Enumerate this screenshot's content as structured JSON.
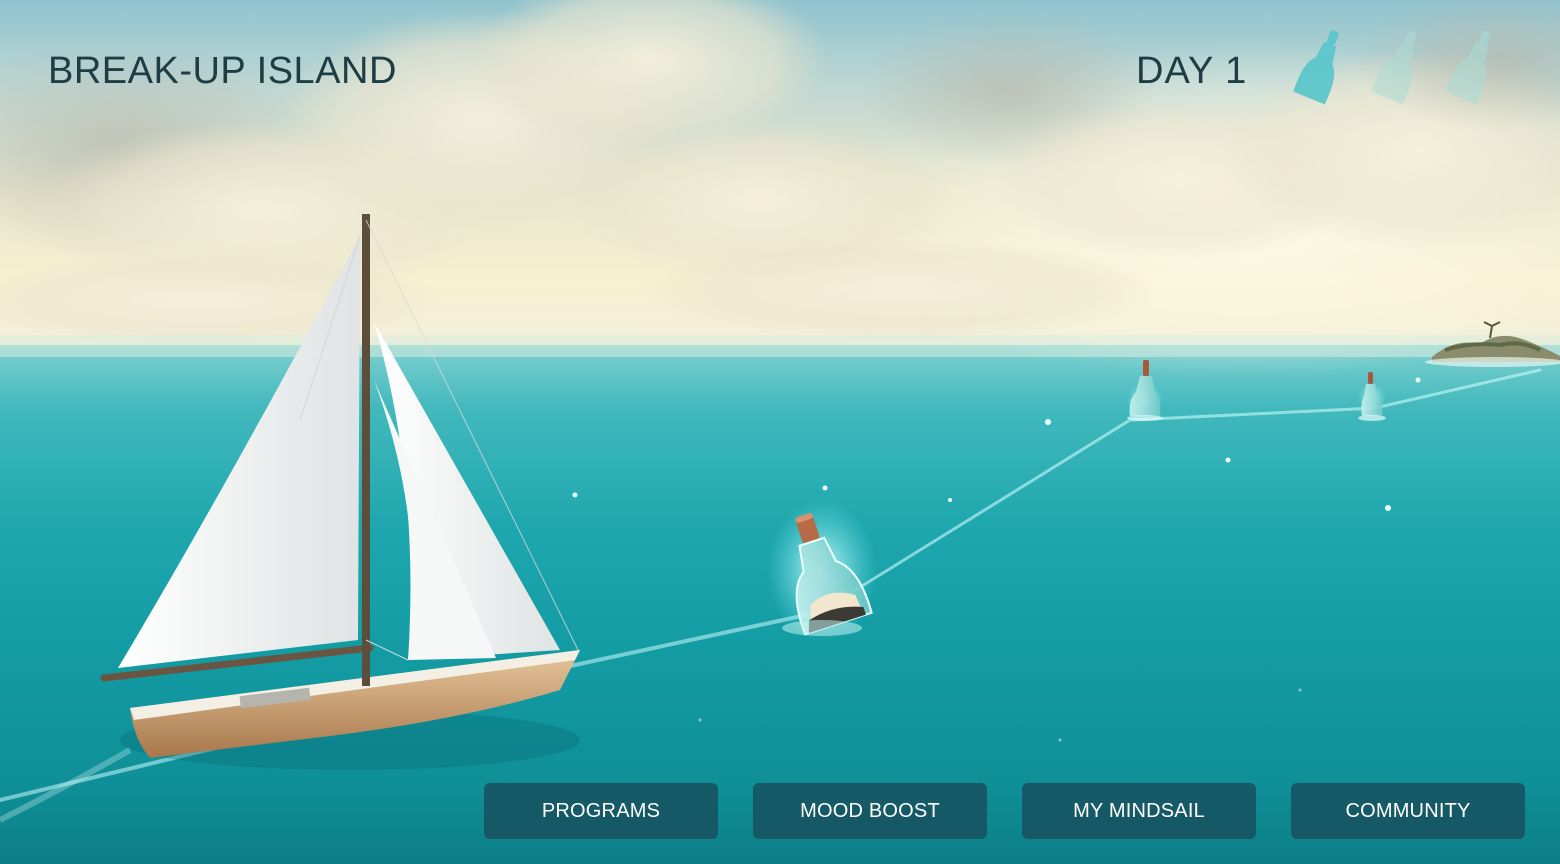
{
  "hud": {
    "location_title": "BREAK-UP ISLAND",
    "day_label": "DAY 1",
    "bottles": [
      {
        "state": "filled",
        "color": "#5cc7cc"
      },
      {
        "state": "empty",
        "color": "#a9dcd6"
      },
      {
        "state": "empty",
        "color": "#a9dcd6"
      }
    ]
  },
  "menu": {
    "items": [
      {
        "label": "PROGRAMS"
      },
      {
        "label": "MOOD BOOST"
      },
      {
        "label": "MY MINDSAIL"
      },
      {
        "label": "COMMUNITY"
      }
    ]
  },
  "colors": {
    "hud_text": "#1d3d45",
    "button_bg": "#175563",
    "button_text": "#ffffff",
    "sea": "#139ba3"
  },
  "scene": {
    "objects": [
      "sailboat",
      "message-bottle-active",
      "message-bottle",
      "message-bottle",
      "island"
    ]
  }
}
